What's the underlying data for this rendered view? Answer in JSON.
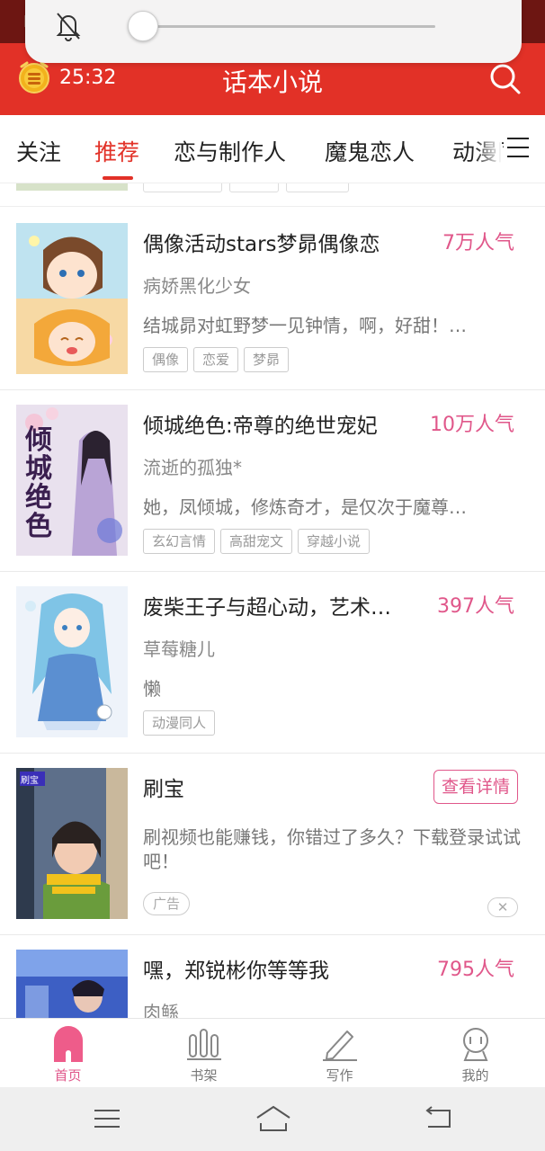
{
  "header": {
    "timer": "25:32",
    "title": "话本小说"
  },
  "colors": {
    "brand_red": "#e23127",
    "accent_pink": "#e0578a"
  },
  "volume_overlay": {
    "level": 0.0,
    "icon": "bell-muted-icon"
  },
  "tabs": [
    {
      "label": "关注",
      "active": false
    },
    {
      "label": "推荐",
      "active": true
    },
    {
      "label": "恋与制作人",
      "active": false
    },
    {
      "label": "魔鬼恋人",
      "active": false
    },
    {
      "label": "动漫同",
      "active": false
    }
  ],
  "books": [
    {
      "title": "偶像活动stars梦昴偶像恋",
      "popularity": "7万人气",
      "author": "病娇黑化少女",
      "description": "结城昴对虹野梦一见钟情，啊，好甜！…",
      "tags": [
        "偶像",
        "恋爱",
        "梦昴"
      ]
    },
    {
      "title": "倾城绝色:帝尊的绝世宠妃",
      "popularity": "10万人气",
      "author": "流逝的孤独*",
      "description": "她，凤倾城，修炼奇才，是仅次于魔尊…",
      "tags": [
        "玄幻言情",
        "高甜宠文",
        "穿越小说"
      ],
      "cover_text": "倾城绝色"
    },
    {
      "title": "废柴王子与超心动，艺术…",
      "popularity": "397人气",
      "author": "草莓糖儿",
      "description": "懒",
      "tags": [
        "动漫同人"
      ]
    }
  ],
  "ad": {
    "title": "刷宝",
    "button": "查看详情",
    "description": "刷视频也能赚钱，你错过了多久？下载登录试试吧！",
    "badge": "广告",
    "close": "✕",
    "cover_tag": "刷宝"
  },
  "last_book": {
    "title": "嘿，郑锐彬你等等我",
    "popularity": "795人气",
    "author": "肉鲧"
  },
  "bottom_nav": [
    {
      "label": "首页",
      "icon": "home-icon",
      "active": true
    },
    {
      "label": "书架",
      "icon": "bookshelf-icon",
      "active": false
    },
    {
      "label": "写作",
      "icon": "pencil-icon",
      "active": false
    },
    {
      "label": "我的",
      "icon": "profile-icon",
      "active": false
    }
  ]
}
